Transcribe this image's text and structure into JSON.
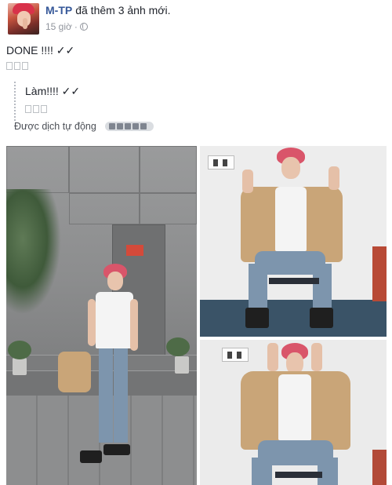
{
  "post": {
    "author": "M-TP",
    "action": "đã thêm 3 ảnh mới.",
    "time": "15 giờ",
    "separator": "·",
    "privacy_icon": "globe-icon",
    "text": "DONE !!!! ✓✓",
    "translation": "Làm!!!! ✓✓",
    "auto_translated_label": "Được dịch tự động",
    "rating_icon": "rating-stars-icon"
  },
  "photos": [
    {
      "name": "photo-main"
    },
    {
      "name": "photo-top-right"
    },
    {
      "name": "photo-bottom-right"
    }
  ],
  "colors": {
    "author_link": "#365899",
    "meta_text": "#90949c",
    "body_text": "#1d2129",
    "hair_red": "#d9556a"
  }
}
